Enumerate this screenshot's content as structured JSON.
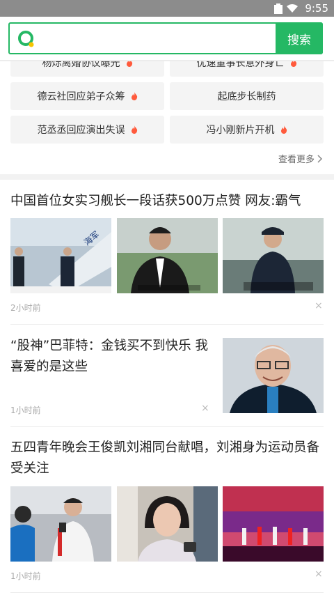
{
  "status_bar": {
    "time": "9:55"
  },
  "search": {
    "placeholder": "",
    "value": "",
    "button_label": "搜索"
  },
  "hot_searches": [
    {
      "label": "杨烁离婚协议曝光",
      "hot": true
    },
    {
      "label": "优速董事长意外身亡",
      "hot": true
    },
    {
      "label": "德云社回应弟子众筹",
      "hot": true
    },
    {
      "label": "起底步长制药",
      "hot": false
    },
    {
      "label": "范丞丞回应演出失误",
      "hot": true
    },
    {
      "label": "冯小刚新片开机",
      "hot": true
    }
  ],
  "more_label": "查看更多",
  "news": [
    {
      "title": "中国首位女实习舰长一段话获500万点赞 网友:霸气",
      "time": "2小时前",
      "close": "×",
      "images": [
        "navy-ceremony",
        "reporter-interview",
        "naval-officer-speech"
      ]
    },
    {
      "title": "“股神”巴菲特：金钱买不到快乐 我喜爱的是这些",
      "time": "1小时前",
      "close": "×",
      "images": [
        "buffett-portrait"
      ]
    },
    {
      "title": "五四青年晚会王俊凯刘湘同台献唱，刘湘身为运动员备受关注",
      "time": "1小时前",
      "close": "×",
      "images": [
        "athlete-interview",
        "woman-phone",
        "stage-performance"
      ]
    }
  ],
  "colors": {
    "brand_green": "#25b864",
    "hot_fire": "#ff5a3c"
  }
}
